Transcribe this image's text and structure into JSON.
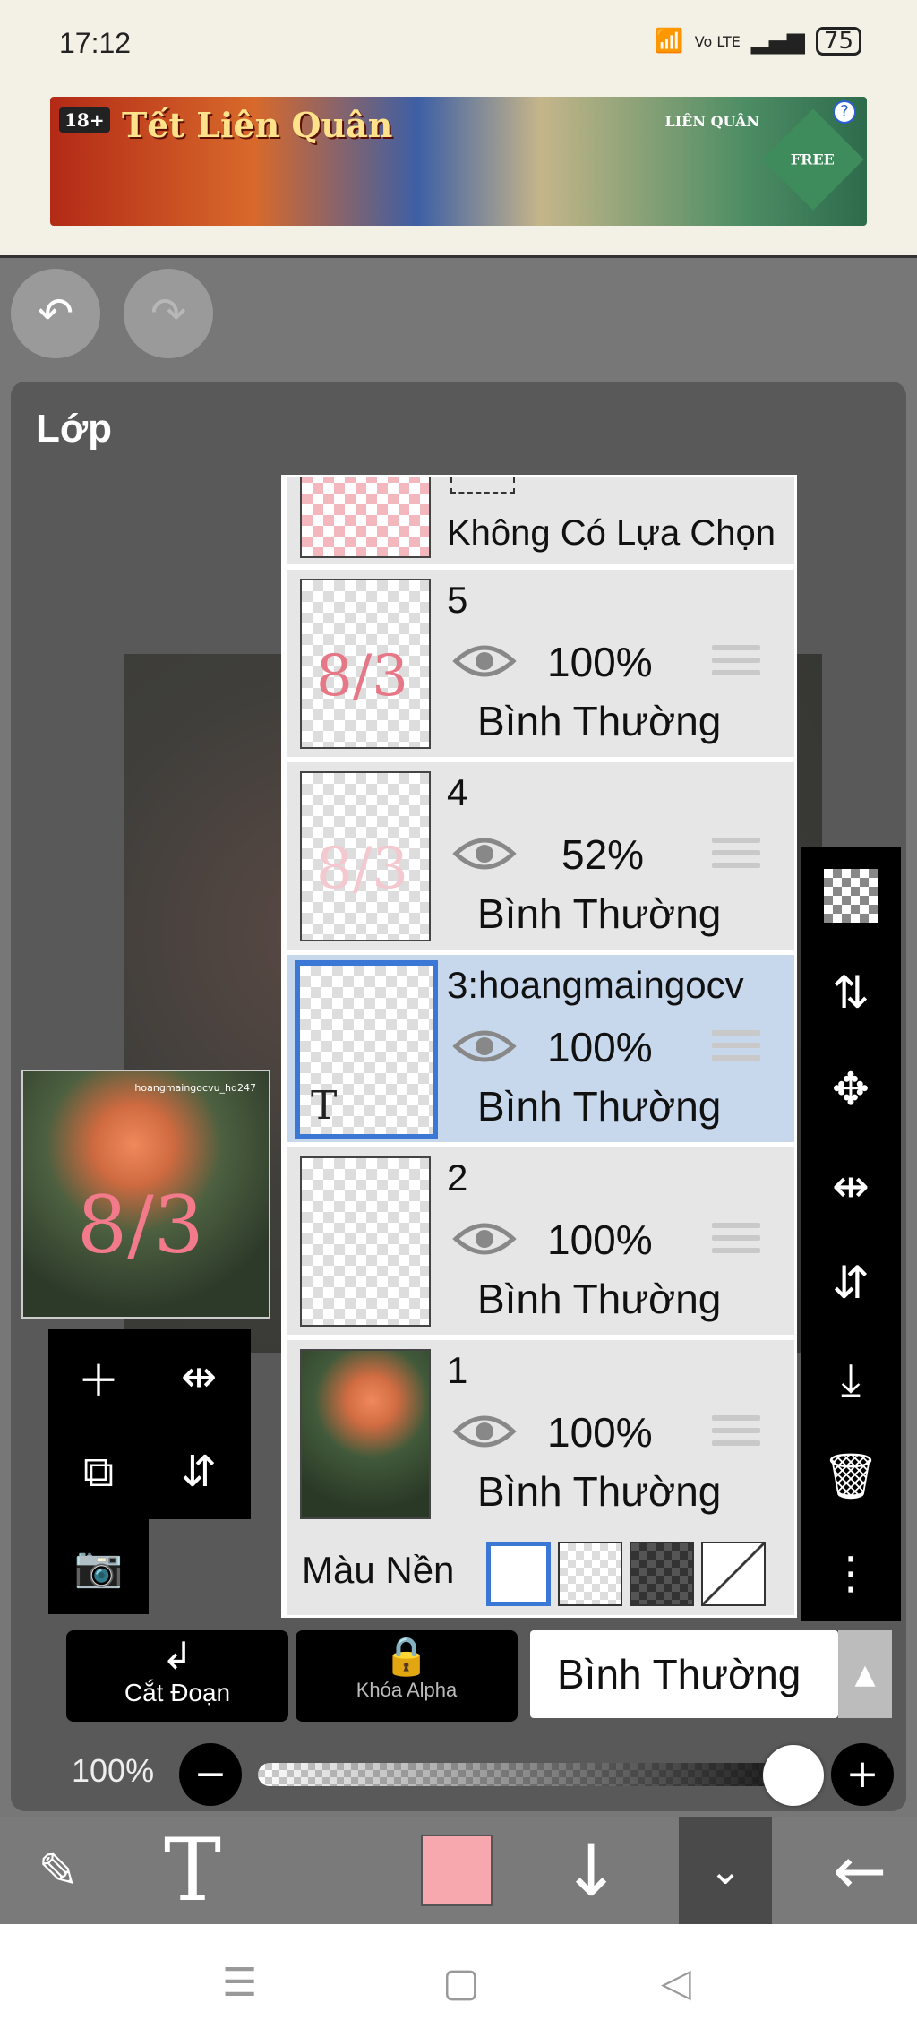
{
  "status": {
    "time": "17:12",
    "battery": "75",
    "network": "Vo LTE"
  },
  "ad": {
    "title": "Tết Liên Quân",
    "age_badge": "18+",
    "brand": "LIÊN QUÂN",
    "free_badge": "FREE",
    "info": "?"
  },
  "panel": {
    "title": "Lớp"
  },
  "selection_row": {
    "label": "Không Có Lựa Chọn"
  },
  "layers": [
    {
      "name": "5",
      "opacity": "100%",
      "blend": "Bình Thường",
      "thumb_text": "8/3"
    },
    {
      "name": "4",
      "opacity": "52%",
      "blend": "Bình Thường",
      "thumb_text": "8/3"
    },
    {
      "name": "3:hoangmaingocv",
      "opacity": "100%",
      "blend": "Bình Thường",
      "thumb_text": "T"
    },
    {
      "name": "2",
      "opacity": "100%",
      "blend": "Bình Thường"
    },
    {
      "name": "1",
      "opacity": "100%",
      "blend": "Bình Thường"
    }
  ],
  "selected_layer": "3:hoangmaingocv",
  "background": {
    "label": "Màu Nền",
    "selected": "white"
  },
  "preview": {
    "text": "8/3",
    "watermark": "hoangmaingocvu_hd247"
  },
  "buttons": {
    "clip": "Cắt Đoạn",
    "alpha_lock": "Khóa Alpha"
  },
  "blend_mode": {
    "value": "Bình Thường"
  },
  "opacity": {
    "label": "100%",
    "value": 1.0
  },
  "colors": {
    "primary": "#f7a8ae",
    "selection": "#3b78d6",
    "selected_row": "#c8d8ec"
  },
  "icons": {
    "undo": "undo-icon",
    "redo": "redo-icon",
    "add": "plus-icon",
    "camera": "camera-icon",
    "move": "move-icon",
    "flip": "flip-icon",
    "merge_down": "merge-down-icon",
    "delete": "trash-icon",
    "more": "more-vertical-icon"
  }
}
